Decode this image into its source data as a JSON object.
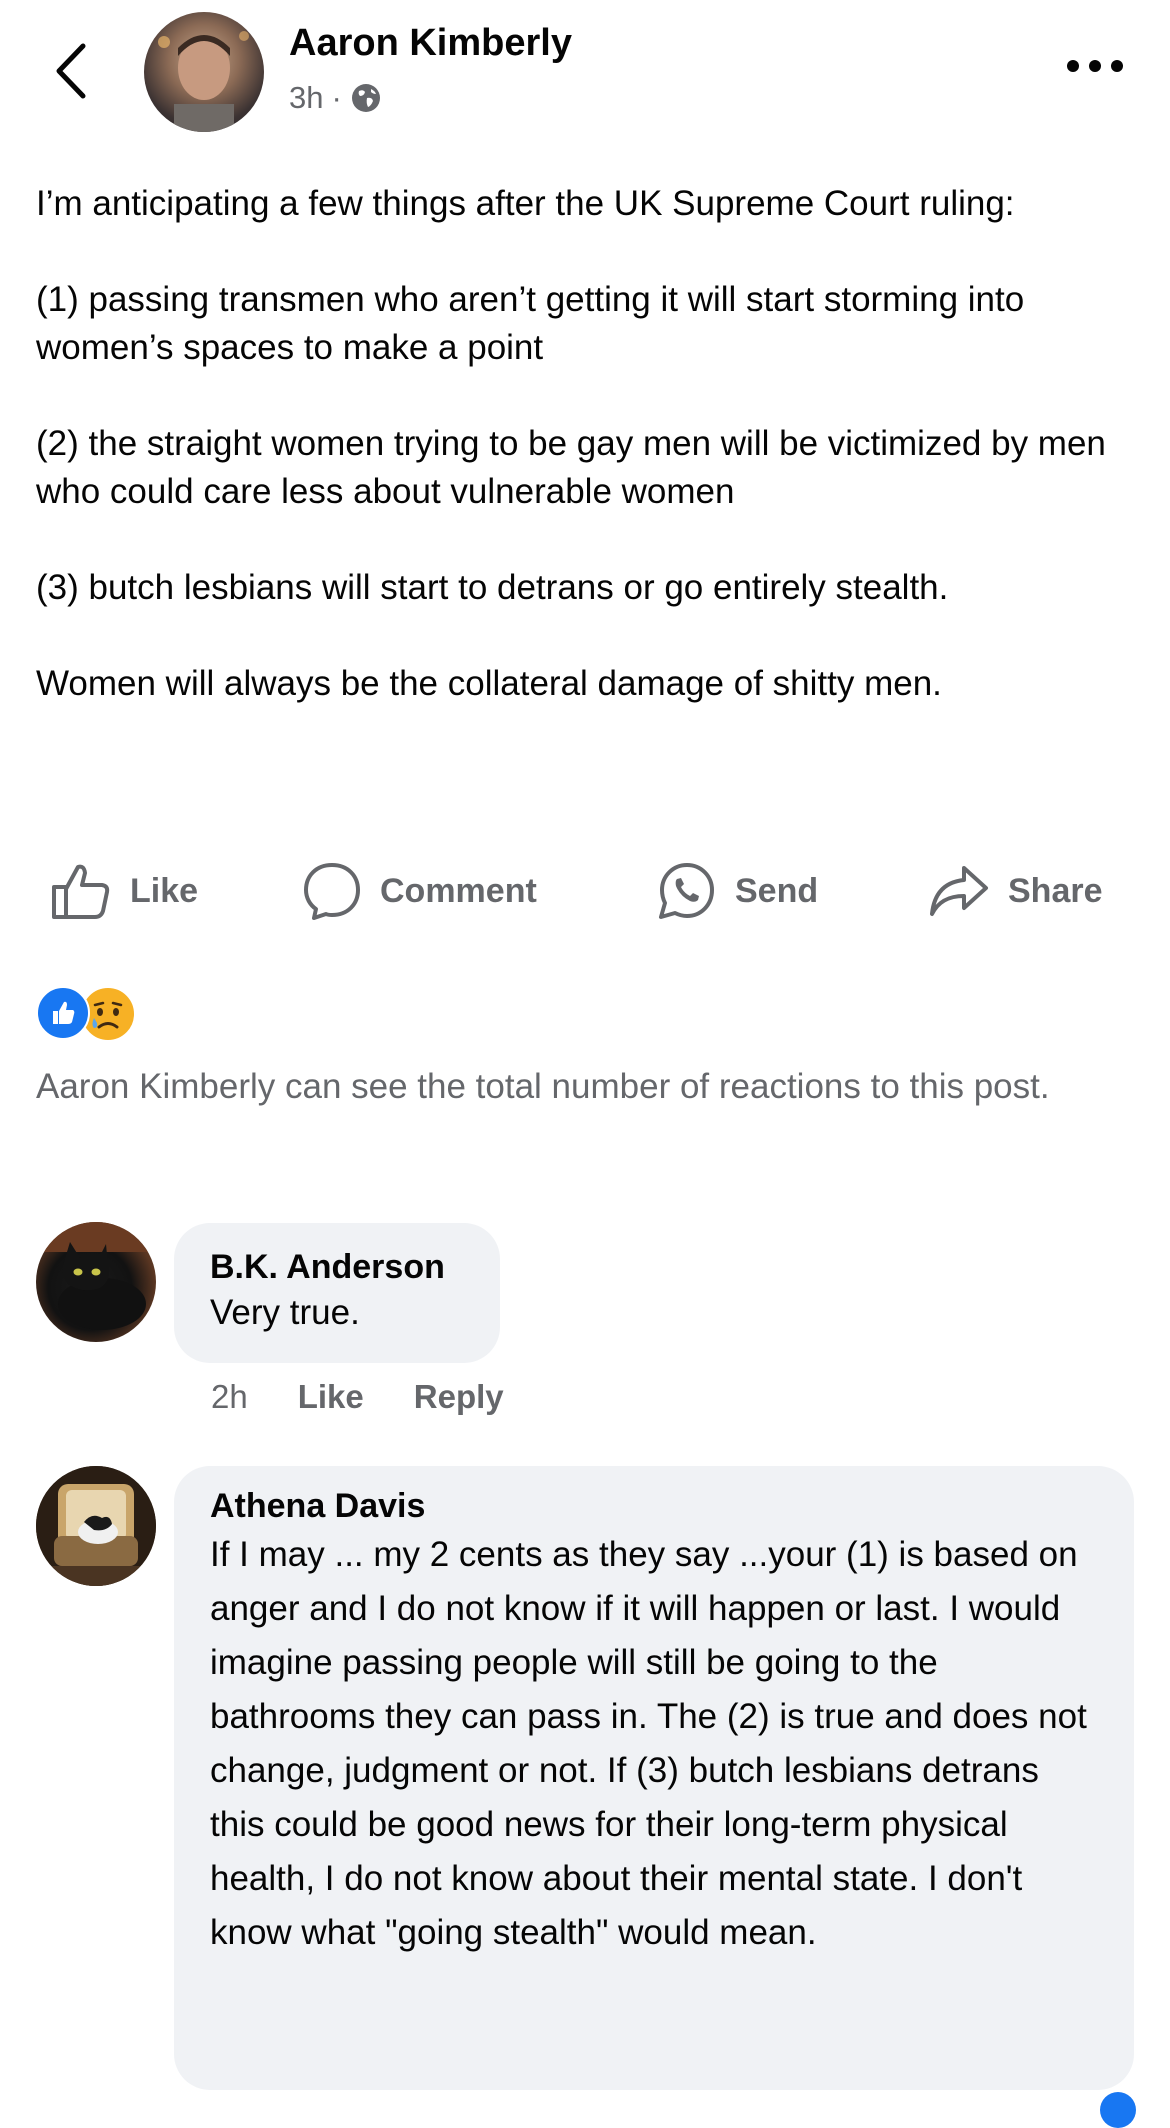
{
  "header": {
    "author_name": "Aaron Kimberly",
    "timestamp": "3h",
    "separator": "·",
    "privacy_icon": "globe-icon",
    "back_icon": "chevron-left-icon",
    "more_icon": "more-horizontal-icon"
  },
  "post": {
    "paragraphs": [
      "I’m anticipating a few things after the UK Supreme Court ruling:",
      "(1) passing transmen who aren’t getting it will start storming into women’s spaces to make a point",
      "(2) the straight women trying to be gay men will be victimized by men who could care less about vulnerable women",
      "(3) butch lesbians will start to detrans or go entirely stealth.",
      "Women will always be the collateral damage of shitty men."
    ]
  },
  "actions": {
    "like": "Like",
    "comment": "Comment",
    "send": "Send",
    "share": "Share"
  },
  "reactions": {
    "types": [
      "like",
      "sad"
    ],
    "note": "Aaron Kimberly can see the total number of reactions to this post."
  },
  "comments": [
    {
      "author": "B.K. Anderson",
      "text": "Very true.",
      "time": "2h",
      "like_label": "Like",
      "reply_label": "Reply"
    },
    {
      "author": "Athena Davis",
      "text": "If I may ... my 2 cents as they say ...your (1) is based on anger and I do not know if it will happen or last. I would imagine passing people will still be going to the bathrooms they can pass in. The (2) is true and does not change, judgment or not. If (3) butch lesbians detrans this could be good news for their long-term physical health, I do not know about their mental state. I don't know what \"going stealth\" would mean."
    }
  ],
  "colors": {
    "text_primary": "#050505",
    "text_secondary": "#65676b",
    "bubble_bg": "#f0f2f5",
    "like_blue": "#1877f2",
    "sad_yellow": "#f7b125"
  }
}
